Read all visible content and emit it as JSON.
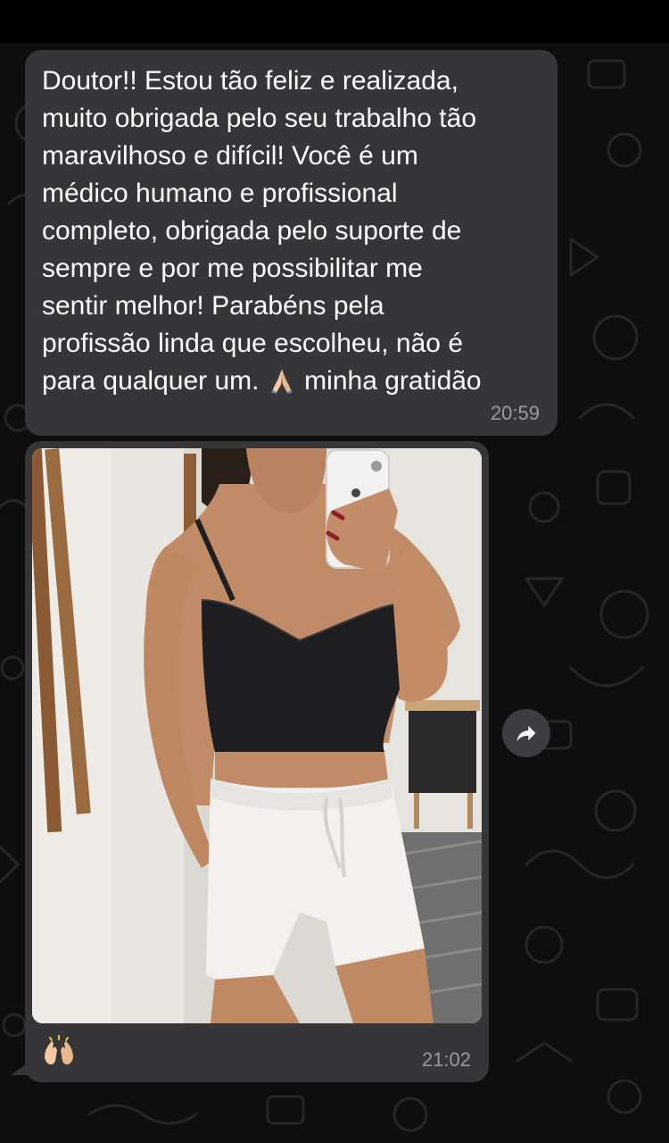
{
  "chat": {
    "messages": [
      {
        "type": "text",
        "text_before_emoji": "Doutor!! Estou tão feliz e realizada,\nmuito obrigada pelo seu trabalho tão\nmaravilhoso e difícil! Você é um\nmédico humano e profissional\ncompleto, obrigada pelo suporte de\nsempre e por me possibilitar me\nsentir melhor! Parabéns pela\nprofissão linda que escolheu, não é\npara qualquer um. ",
        "emoji": "folded-hands",
        "text_after_emoji": " minha gratidão",
        "time": "20:59"
      },
      {
        "type": "photo",
        "caption_emoji": "raising-hands",
        "time": "21:02"
      }
    ],
    "forward_icon": "forward-arrow-icon"
  },
  "colors": {
    "background": "#0e0e0e",
    "bubble": "#363638",
    "timestamp": "#9a9a9e",
    "text": "#ffffff"
  }
}
